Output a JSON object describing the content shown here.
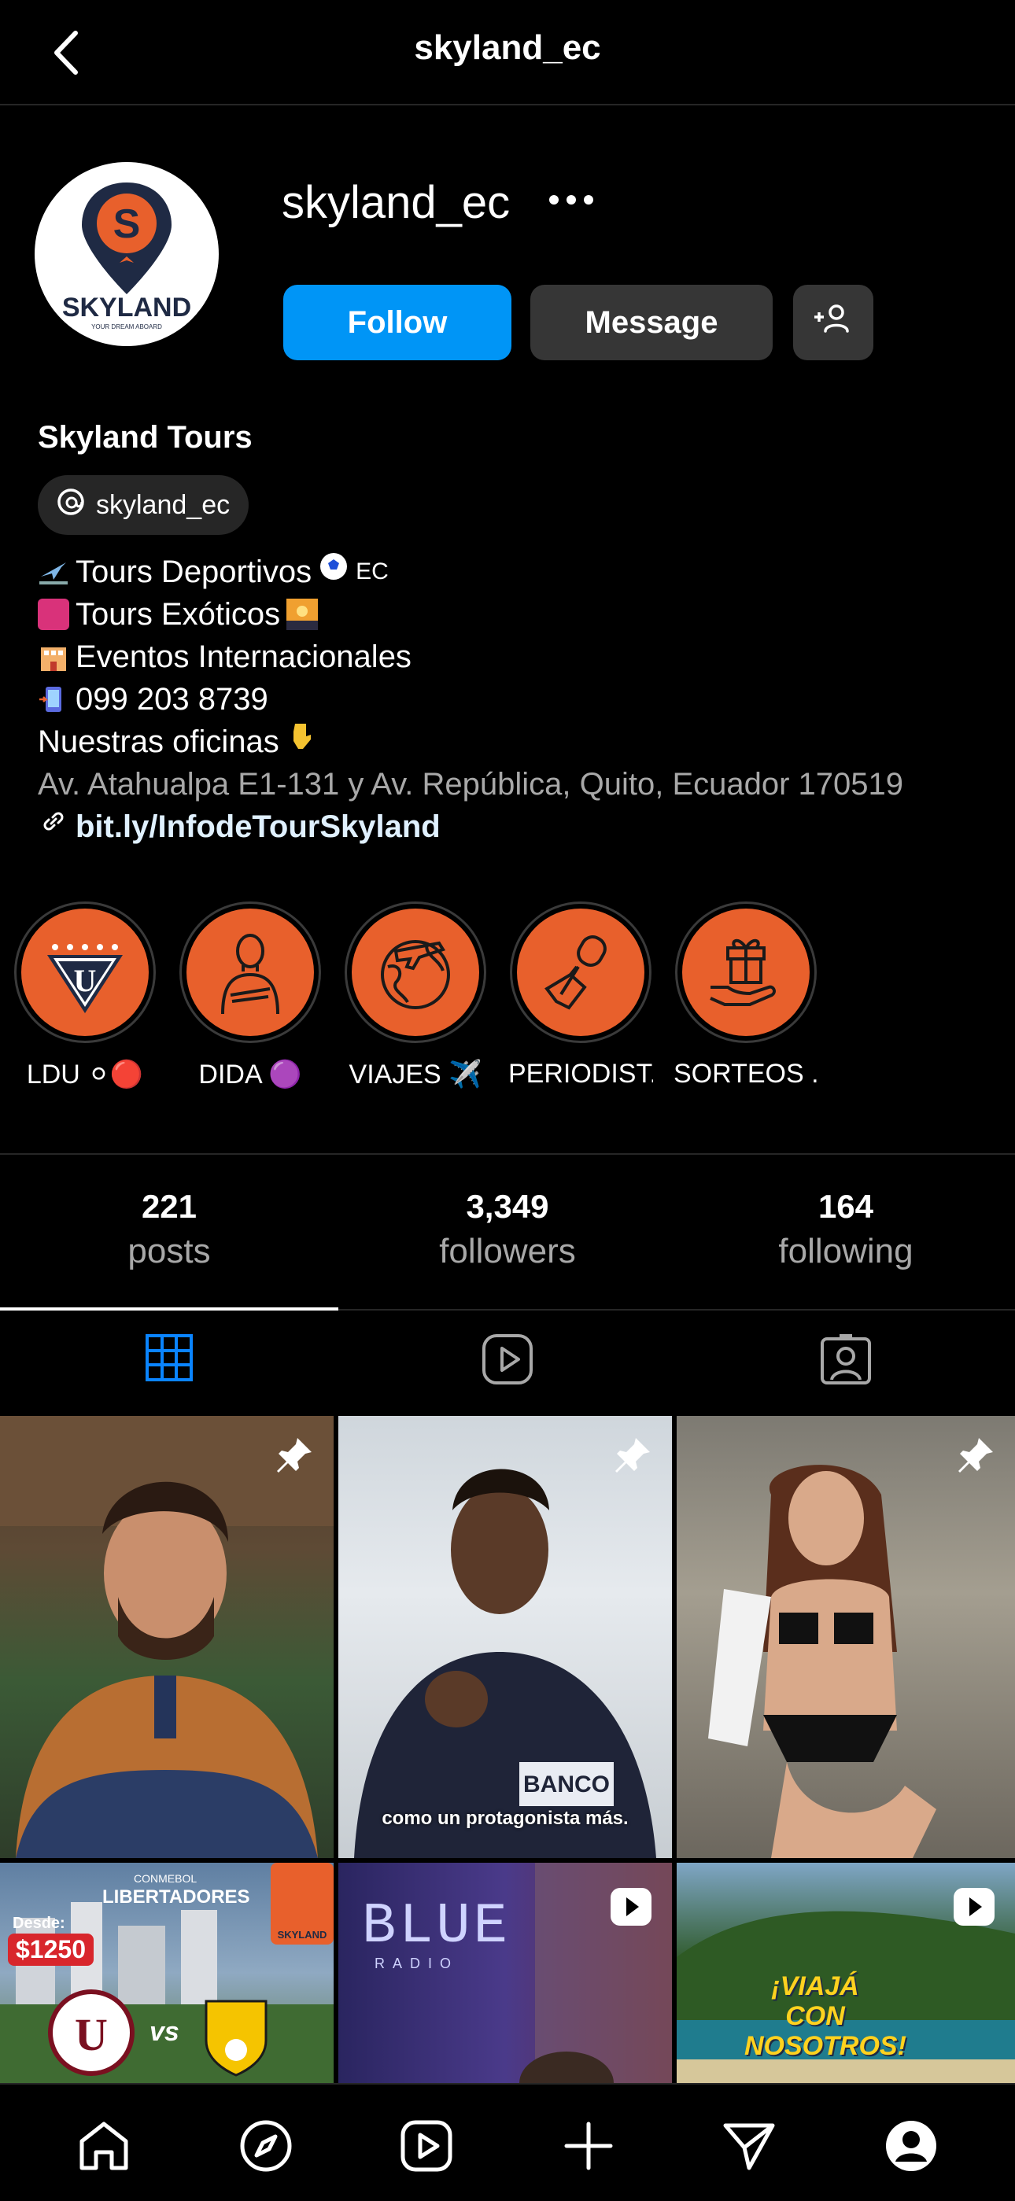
{
  "header": {
    "title": "skyland_ec"
  },
  "profile": {
    "username": "skyland_ec",
    "display_name": "Skyland Tours",
    "threads_handle": "skyland_ec",
    "avatar_logo_text": "SKYLAND",
    "avatar_tagline": "YOUR DREAM ABOARD",
    "follow_label": "Follow",
    "message_label": "Message",
    "bio": {
      "line1": "Tours Deportivos",
      "line1_suffix": "EC",
      "line2": "Tours Exóticos",
      "line3": "Eventos Internacionales",
      "line4": "099 203 8739",
      "line5": "Nuestras oficinas",
      "address": "Av. Atahualpa E1-131 y Av. República, Quito, Ecuador 170519",
      "link": "bit.ly/InfodeTourSkyland"
    }
  },
  "highlights": [
    {
      "label": "LDU ⚪🔴",
      "icon": "ldu-crest-icon"
    },
    {
      "label": "DIDA 🟣",
      "icon": "person-icon"
    },
    {
      "label": "VIAJES ✈️",
      "icon": "globe-plane-icon"
    },
    {
      "label": "PERIODIST...",
      "icon": "microphone-hand-icon"
    },
    {
      "label": "SORTEOS ...",
      "icon": "gift-icon"
    }
  ],
  "stats": {
    "posts": {
      "value": "221",
      "label": "posts"
    },
    "followers": {
      "value": "3,349",
      "label": "followers"
    },
    "following": {
      "value": "164",
      "label": "following"
    }
  },
  "tabs": [
    "grid-icon",
    "reels-icon",
    "tagged-icon"
  ],
  "posts": [
    {
      "type": "pinned",
      "caption": ""
    },
    {
      "type": "pinned",
      "caption": "como un protagonista más."
    },
    {
      "type": "pinned",
      "caption": ""
    },
    {
      "type": "image",
      "overlay_top": "LIBERTADORES",
      "overlay_small": "CONMEBOL",
      "price_label": "Desde:",
      "price": "$1250",
      "vs": "vs",
      "logo": "SKYLAND"
    },
    {
      "type": "reel",
      "overlay": "BLUE",
      "overlay_small": "RADIO"
    },
    {
      "type": "reel",
      "overlay": "¡VIAJÁ CON NOSOTROS!"
    }
  ],
  "colors": {
    "accent": "#0095f6",
    "brand_orange": "#e8602c",
    "brand_navy": "#1f2a44"
  },
  "bottom_nav": [
    "home-icon",
    "explore-icon",
    "reels-icon",
    "create-icon",
    "direct-icon",
    "profile-icon"
  ]
}
